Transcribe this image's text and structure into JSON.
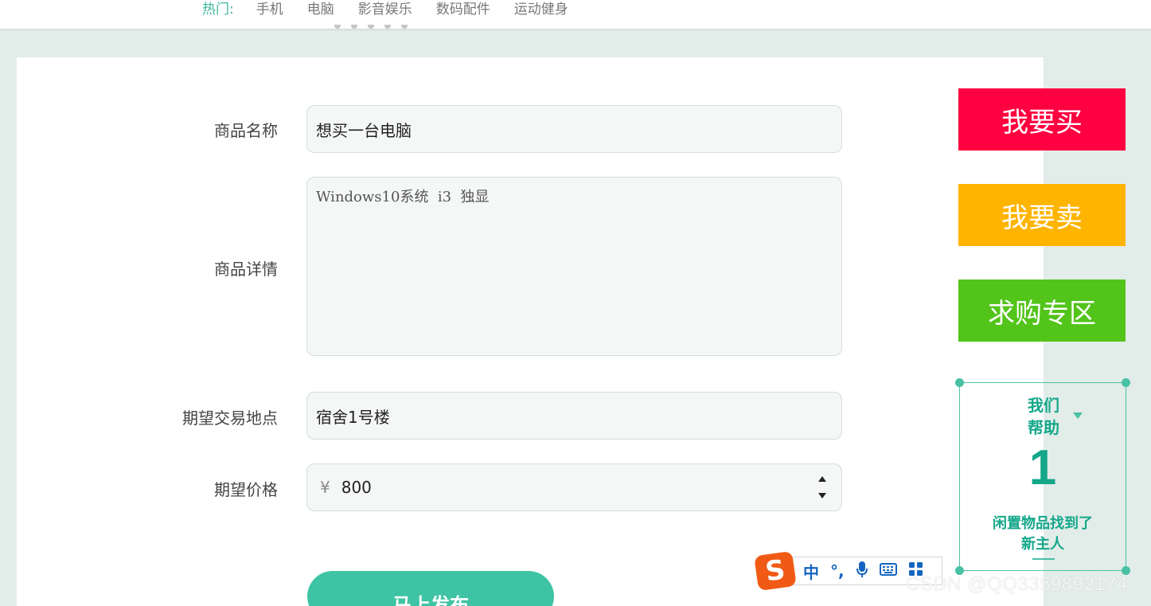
{
  "nav": {
    "hot_label": "热门:",
    "links": [
      "手机",
      "电脑",
      "影音娱乐",
      "数码配件",
      "运动健身"
    ]
  },
  "form": {
    "name": {
      "label": "商品名称",
      "value": "想买一台电脑"
    },
    "detail": {
      "label": "商品详情",
      "value": "Windows10系统  i3  独显"
    },
    "location": {
      "label": "期望交易地点",
      "value": "宿舍1号楼"
    },
    "price": {
      "label": "期望价格",
      "currency": "¥",
      "value": "800"
    },
    "submit_label": "马上发布"
  },
  "side": {
    "buy": {
      "label": "我要买",
      "color": "#ff0040"
    },
    "sell": {
      "label": "我要卖",
      "color": "#ffb400"
    },
    "wanted": {
      "label": "求购专区",
      "color": "#52c41a"
    }
  },
  "help": {
    "title_line1": "我们",
    "title_line2": "帮助",
    "count": "1",
    "sub_line1": "闲置物品找到了",
    "sub_line2": "新主人"
  },
  "ime": {
    "logo": "S",
    "mode": "中",
    "punct": "°,",
    "icons": [
      "microphone-icon",
      "keyboard-icon",
      "grid-icon"
    ]
  },
  "watermark": "CSDN @QQ3359892174"
}
